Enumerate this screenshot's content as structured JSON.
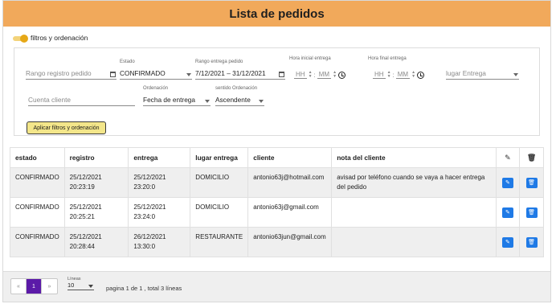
{
  "page": {
    "title": "Lista de pedidos"
  },
  "filters_toggle": {
    "label": "filtros y ordenación",
    "on": true,
    "color": "#e6a817"
  },
  "filters": {
    "rango_registro": {
      "placeholder": "Rango registro pedido"
    },
    "estado": {
      "label": "Estado",
      "value": "CONFIRMADO"
    },
    "rango_entrega": {
      "label": "Rango entrega pedido",
      "value": "7/12/2021 – 31/12/2021"
    },
    "hora_inicial": {
      "label": "Hora inicial entrega",
      "hh": "HH",
      "mm": "MM",
      "sep": ":"
    },
    "hora_final": {
      "label": "Hora final entrega",
      "hh": "HH",
      "mm": "MM",
      "sep": ":"
    },
    "lugar_entrega": {
      "placeholder": "lugar Entrega"
    },
    "cuenta_cliente": {
      "placeholder": "Cuenta cliente"
    },
    "ordenacion": {
      "label": "Ordenación",
      "value": "Fecha de entrega"
    },
    "sentido": {
      "label": "sentido Ordenación",
      "value": "Ascendente"
    },
    "apply_label": "Aplicar filtros y ordenación"
  },
  "table": {
    "columns": [
      "estado",
      "registro",
      "entrega",
      "lugar entrega",
      "cliente",
      "nota del cliente"
    ],
    "rows": [
      {
        "estado": "CONFIRMADO",
        "registro_fecha": "25/12/2021",
        "registro_hora": "20:23:19",
        "entrega_fecha": "25/12/2021",
        "entrega_hora": "23:20:0",
        "lugar": "DOMICILIO",
        "cliente": "antonio63j@hotmail.com",
        "nota": "avisad por teléfono cuando se vaya a hacer entrega del pedido"
      },
      {
        "estado": "CONFIRMADO",
        "registro_fecha": "25/12/2021",
        "registro_hora": "20:25:21",
        "entrega_fecha": "25/12/2021",
        "entrega_hora": "23:24:0",
        "lugar": "DOMICILIO",
        "cliente": "antonio63j@gmail.com",
        "nota": ""
      },
      {
        "estado": "CONFIRMADO",
        "registro_fecha": "25/12/2021",
        "registro_hora": "20:28:44",
        "entrega_fecha": "26/12/2021",
        "entrega_hora": "13:30:0",
        "lugar": "RESTAURANTE",
        "cliente": "antonio63jun@gmail.com",
        "nota": ""
      }
    ]
  },
  "pagination": {
    "prev": "«",
    "current": "1",
    "next": "»",
    "lines_label": "Líneas",
    "lines_value": "10",
    "info": "pagina 1 de 1 , total 3 líneas"
  },
  "colors": {
    "header": "#f1a95b",
    "action_button": "#1f7ae6",
    "active_page": "#5b1aa8",
    "apply_button": "#f3e68a"
  }
}
